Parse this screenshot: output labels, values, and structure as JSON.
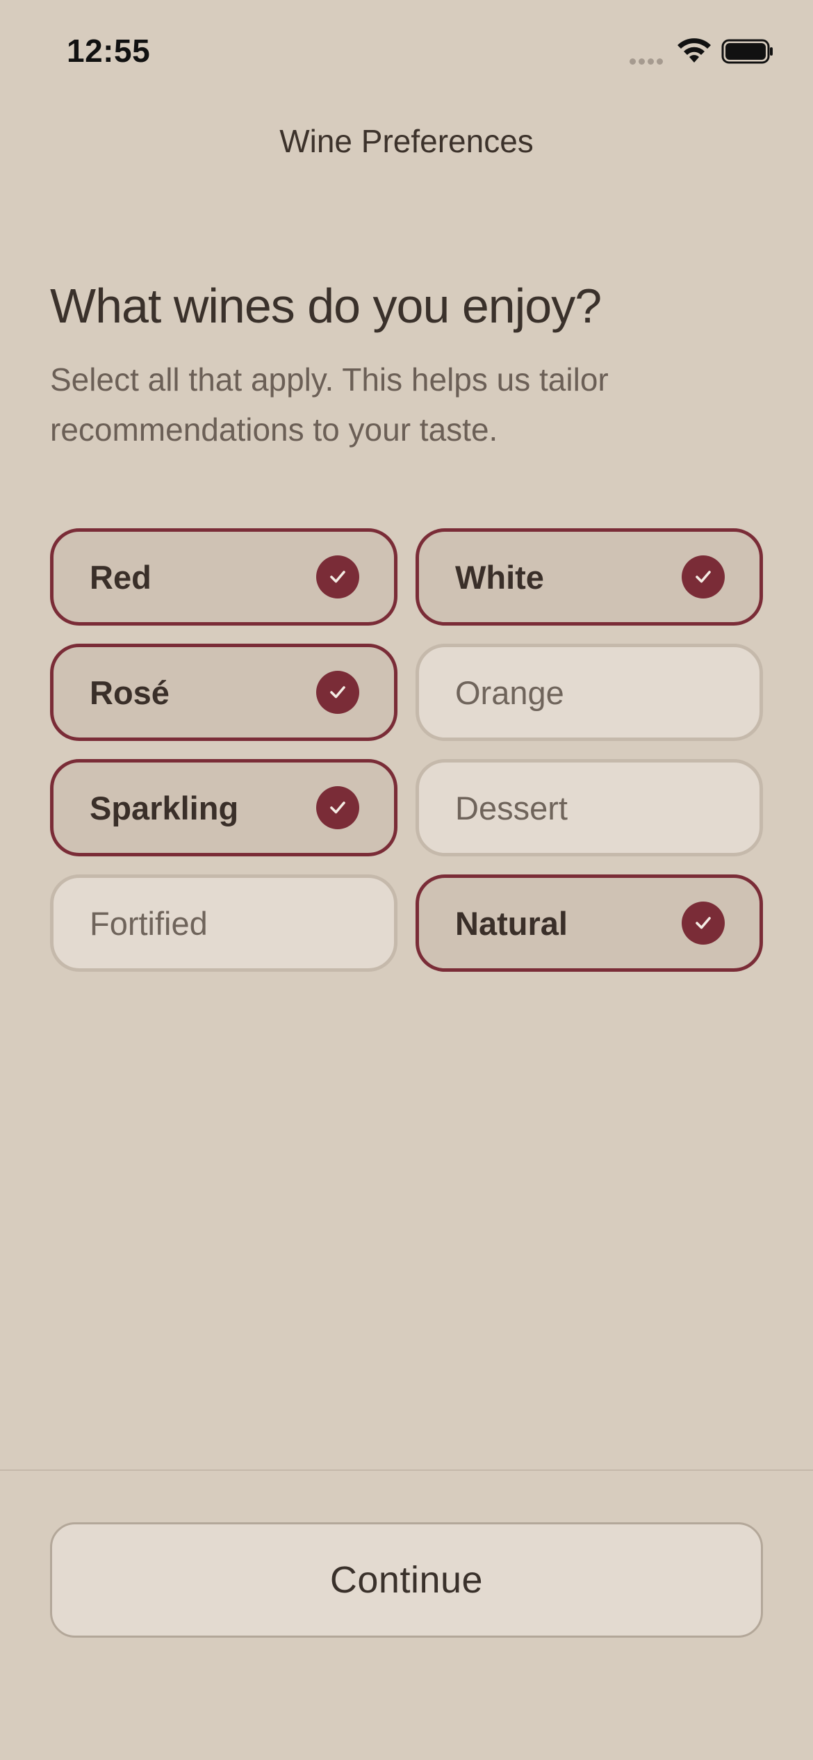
{
  "status_bar": {
    "time": "12:55"
  },
  "nav": {
    "title": "Wine Preferences"
  },
  "main": {
    "heading": "What wines do you enjoy?",
    "subheading": "Select all that apply. This helps us tailor recommendations to your taste."
  },
  "options": [
    {
      "label": "Red",
      "selected": true
    },
    {
      "label": "White",
      "selected": true
    },
    {
      "label": "Rosé",
      "selected": true
    },
    {
      "label": "Orange",
      "selected": false
    },
    {
      "label": "Sparkling",
      "selected": true
    },
    {
      "label": "Dessert",
      "selected": false
    },
    {
      "label": "Fortified",
      "selected": false
    },
    {
      "label": "Natural",
      "selected": true
    }
  ],
  "footer": {
    "continue_label": "Continue"
  },
  "colors": {
    "background": "#d7ccbe",
    "accent": "#7a2c37",
    "selected_fill": "#cfc2b4",
    "unselected_fill": "#e3dad0"
  },
  "icons": {
    "status": [
      "signal-icon",
      "wifi-icon",
      "battery-icon"
    ],
    "selected_marker": "check-icon"
  }
}
